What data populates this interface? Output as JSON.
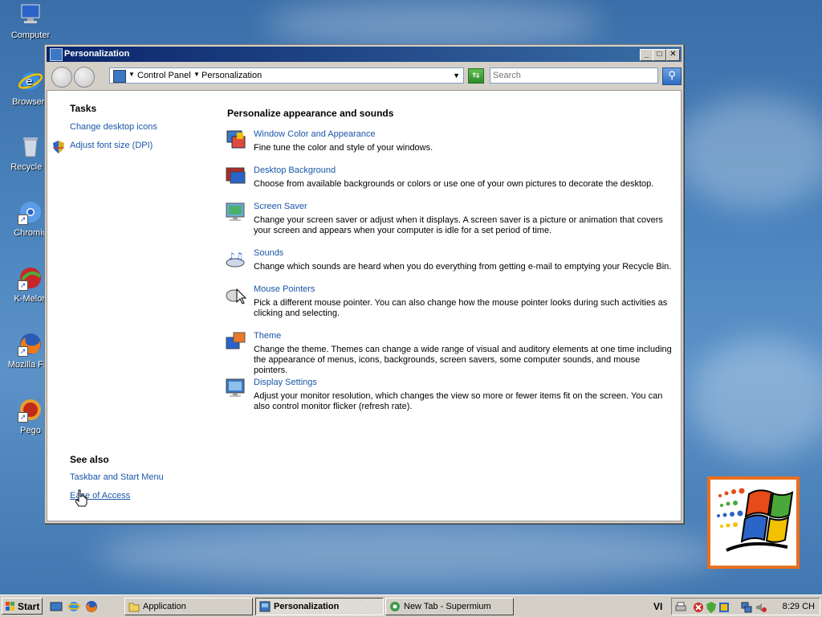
{
  "desktop": {
    "icons": [
      {
        "label": "Computer",
        "icon": "computer-icon"
      },
      {
        "label": "Browserv",
        "icon": "internet-explorer-icon"
      },
      {
        "label": "Recycle B",
        "icon": "recycle-bin-icon"
      },
      {
        "label": "Chromiu",
        "icon": "chromium-icon"
      },
      {
        "label": "K-Melon",
        "icon": "k-meleon-icon"
      },
      {
        "label": "Mozilla Fire",
        "icon": "firefox-icon"
      },
      {
        "label": "Pego",
        "icon": "pego-icon"
      }
    ]
  },
  "window": {
    "title": "Personalization",
    "controls": {
      "minimize": "_",
      "maximize": "□",
      "close": "✕"
    },
    "address": {
      "crumbs": [
        "Control Panel",
        "Personalization"
      ]
    },
    "search": {
      "placeholder": "Search"
    },
    "left_panel": {
      "tasks_heading": "Tasks",
      "tasks": [
        {
          "label": "Change desktop icons",
          "shield": false
        },
        {
          "label": "Adjust font size (DPI)",
          "shield": true
        }
      ],
      "see_also_heading": "See also",
      "see_also": [
        "Taskbar and Start Menu",
        "Ease of Access"
      ]
    },
    "main": {
      "heading": "Personalize appearance and sounds",
      "items": [
        {
          "title": "Window Color and Appearance",
          "desc": "Fine tune the color and style of your windows.",
          "icon": "window-color-icon"
        },
        {
          "title": "Desktop Background",
          "desc": "Choose from available backgrounds or colors or use one of your own pictures to decorate the desktop.",
          "icon": "desktop-background-icon"
        },
        {
          "title": "Screen Saver",
          "desc": "Change your screen saver or adjust when it displays. A screen saver is a picture or animation that covers your screen and appears when your computer is idle for a set period of time.",
          "icon": "screen-saver-icon"
        },
        {
          "title": "Sounds",
          "desc": "Change which sounds are heard when you do everything from getting e-mail to emptying your Recycle Bin.",
          "icon": "sounds-icon"
        },
        {
          "title": "Mouse Pointers",
          "desc": "Pick a different mouse pointer. You can also change how the mouse pointer looks during such activities as clicking and selecting.",
          "icon": "mouse-pointers-icon"
        },
        {
          "title": "Theme",
          "desc": "Change the theme. Themes can change a wide range of visual and auditory elements at one time including the appearance of menus, icons, backgrounds, screen savers, some computer sounds, and mouse pointers.",
          "icon": "theme-icon"
        },
        {
          "title": "Display Settings",
          "desc": "Adjust your monitor resolution, which changes the view so more or fewer items fit on the screen. You can also control monitor flicker (refresh rate).",
          "icon": "display-settings-icon"
        }
      ]
    }
  },
  "taskbar": {
    "start_label": "Start",
    "tasks": [
      {
        "label": "Application",
        "icon": "folder-icon",
        "active": false
      },
      {
        "label": "Personalization",
        "icon": "control-panel-icon",
        "active": true
      },
      {
        "label": "New Tab - Supermium",
        "icon": "supermium-icon",
        "active": false
      }
    ],
    "language": "VI",
    "clock": "8:29 CH"
  },
  "colors": {
    "link": "#1a56a8",
    "titlebar": "#0a246a",
    "logo_border": "#e96f1e"
  }
}
